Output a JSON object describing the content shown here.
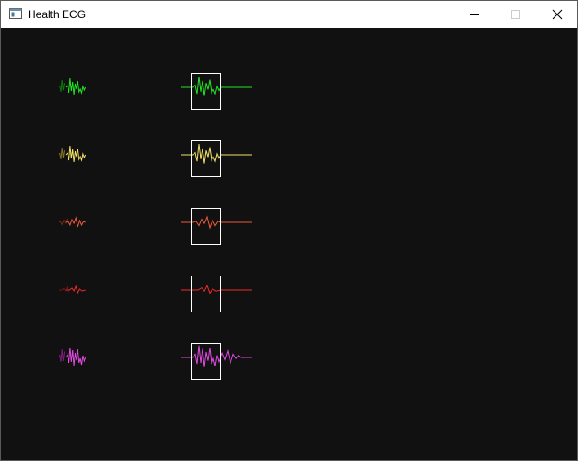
{
  "window": {
    "title": "Health ECG",
    "app_icon": "window-app-icon",
    "controls": [
      "minimize-icon",
      "maximize-icon",
      "close-icon"
    ]
  },
  "colors": {
    "background": "#111111",
    "frame": "#ffffff"
  },
  "leads": [
    {
      "color": "#22e522",
      "dim_color": "#0a7a0a",
      "trace": "tall"
    },
    {
      "color": "#f2e268",
      "dim_color": "#7c7228",
      "trace": "tall"
    },
    {
      "color": "#f0583a",
      "dim_color": "#7a2818",
      "trace": "medium"
    },
    {
      "color": "#ee2a2a",
      "dim_color": "#7a1414",
      "trace": "small"
    },
    {
      "color": "#e34ae3",
      "dim_color": "#7a1e7a",
      "trace": "tall-long"
    }
  ]
}
